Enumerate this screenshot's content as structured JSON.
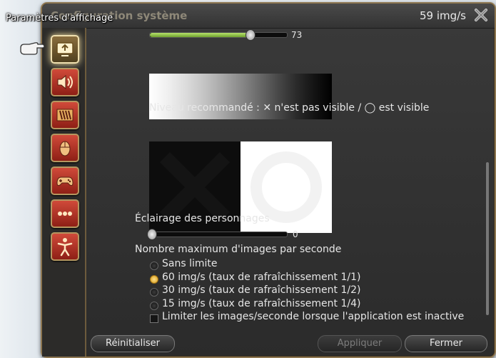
{
  "window": {
    "title": "Configuration système",
    "fps": "59 img/s",
    "tooltip": "Paramètres d'affichage"
  },
  "sidebar": {
    "items": [
      {
        "icon": "display-icon",
        "active": true
      },
      {
        "icon": "speaker-icon",
        "active": false
      },
      {
        "icon": "hotbar-icon",
        "active": false
      },
      {
        "icon": "mouse-icon",
        "active": false
      },
      {
        "icon": "gamepad-icon",
        "active": false
      },
      {
        "icon": "more-icon",
        "active": false
      },
      {
        "icon": "character-icon",
        "active": false
      }
    ]
  },
  "content": {
    "brightness_value": "73",
    "brightness_fraction": 0.73,
    "recommended_label": "Niveau recommandé : ✕ n'est pas visible / ◯ est visible",
    "character_light_label": "Éclairage des personnages",
    "character_light_value": "0",
    "character_light_fraction": 0.0,
    "fps_limit_label": "Nombre maximum d'images par seconde",
    "fps_options": [
      {
        "label": "Sans limite",
        "selected": false
      },
      {
        "label": "60 img/s (taux de rafraîchissement 1/1)",
        "selected": true
      },
      {
        "label": "30 img/s (taux de rafraîchissement 1/2)",
        "selected": false
      },
      {
        "label": "15 img/s (taux de rafraîchissement 1/4)",
        "selected": false
      }
    ],
    "inactive_limit_label": "Limiter les images/seconde lorsque l'application est inactive",
    "inactive_limit_checked": false
  },
  "footer": {
    "reset_label": "Réinitialiser",
    "apply_label": "Appliquer",
    "close_label": "Fermer"
  },
  "colors": {
    "accent": "#8d7650",
    "slider_fill": "#9ccc50",
    "radio_selected": "#e0a820"
  }
}
